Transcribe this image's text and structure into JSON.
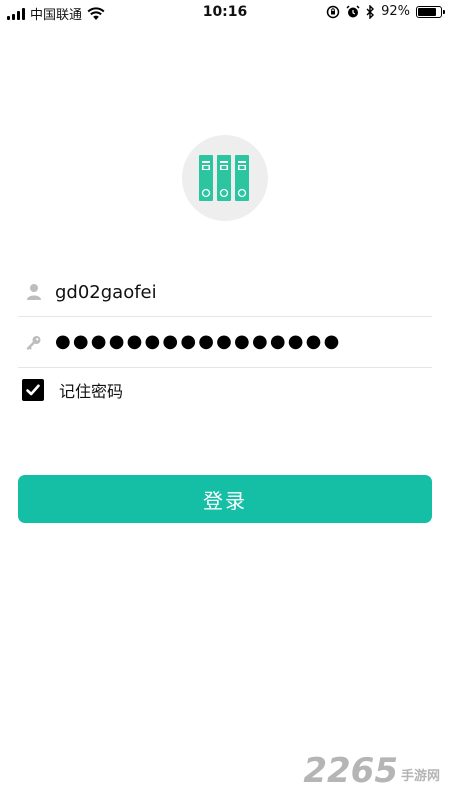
{
  "status_bar": {
    "carrier": "中国联通",
    "time": "10:16",
    "battery_text": "92%",
    "battery_level": 0.92,
    "icons": [
      "signal-icon",
      "wifi-icon",
      "rotation-lock-icon",
      "alarm-icon",
      "bluetooth-icon",
      "battery-icon"
    ]
  },
  "logo": {
    "icon": "binders-icon",
    "colors": {
      "circle": "#eeeeee",
      "binder": "#2bc6a0"
    }
  },
  "login_form": {
    "username": {
      "icon": "user-icon",
      "value": "gd02gaofei"
    },
    "password": {
      "icon": "key-icon",
      "masked_value": "●●●●●●●●●●●●●●●●"
    },
    "remember": {
      "label": "记住密码",
      "checked": true,
      "icon": "checkmark-icon"
    },
    "submit_label": "登录"
  },
  "colors": {
    "accent": "#14bfa6"
  },
  "watermark": {
    "number": "2265",
    "text": "手游网"
  }
}
